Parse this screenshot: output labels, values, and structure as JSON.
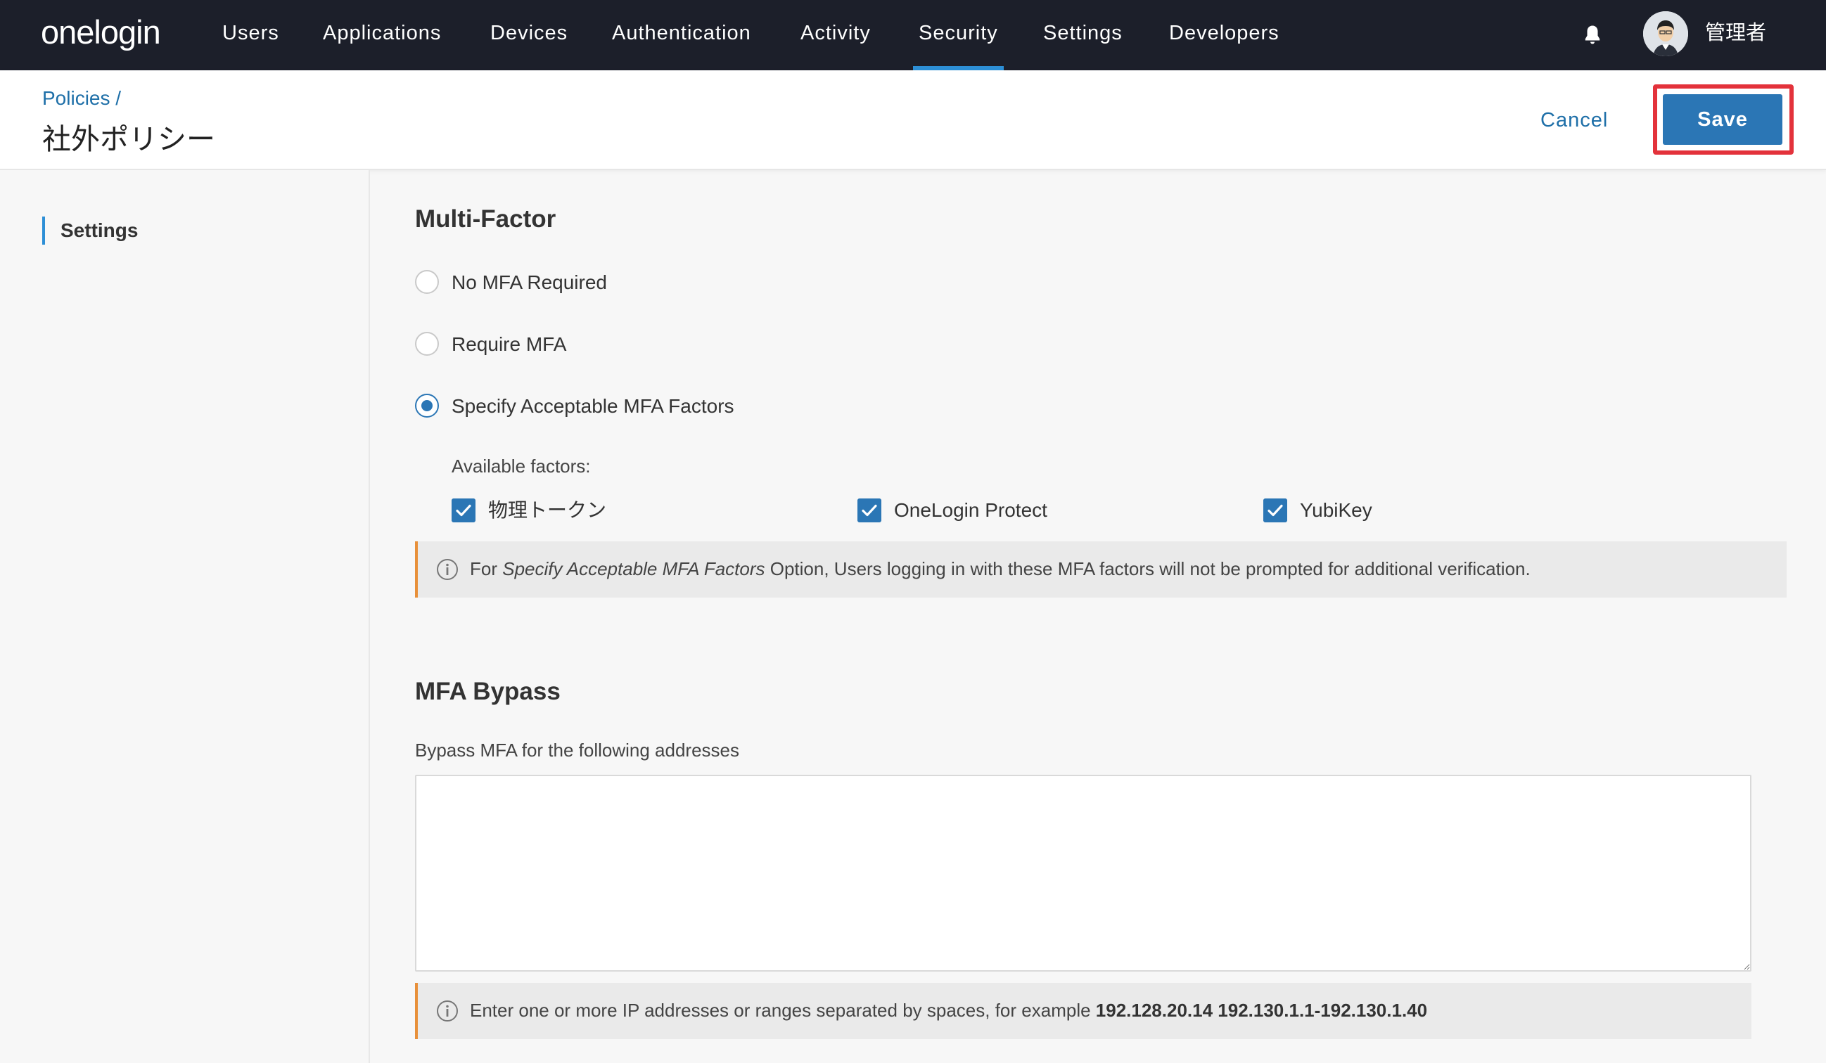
{
  "app": {
    "logo": "onelogin"
  },
  "nav": {
    "items": [
      {
        "label": "Users"
      },
      {
        "label": "Applications"
      },
      {
        "label": "Devices"
      },
      {
        "label": "Authentication"
      },
      {
        "label": "Activity"
      },
      {
        "label": "Security",
        "active": true
      },
      {
        "label": "Settings"
      },
      {
        "label": "Developers"
      }
    ],
    "bell_icon": "bell-icon",
    "user": {
      "name": "管理者"
    }
  },
  "header": {
    "breadcrumb": "Policies /",
    "title": "社外ポリシー",
    "cancel_label": "Cancel",
    "save_label": "Save"
  },
  "sidebar": {
    "items": [
      {
        "label": "Settings",
        "active": true
      }
    ]
  },
  "multifactor": {
    "title": "Multi-Factor",
    "options": [
      {
        "label": "No MFA Required",
        "checked": false
      },
      {
        "label": "Require MFA",
        "checked": false
      },
      {
        "label": "Specify Acceptable MFA Factors",
        "checked": true
      }
    ],
    "available_label": "Available factors:",
    "factors": [
      {
        "label": "物理トークン",
        "checked": true
      },
      {
        "label": "OneLogin Protect",
        "checked": true
      },
      {
        "label": "YubiKey",
        "checked": true
      }
    ],
    "info": {
      "prefix": "For ",
      "emphasis": "Specify Acceptable MFA Factors",
      "suffix": " Option, Users logging in with these MFA factors will not be prompted for additional verification."
    }
  },
  "bypass": {
    "title": "MFA Bypass",
    "label": "Bypass MFA for the following addresses",
    "value": "",
    "info": {
      "prefix": "Enter one or more IP addresses or ranges separated by spaces, for example ",
      "example": "192.128.20.14 192.130.1.1-192.130.1.40"
    }
  },
  "colors": {
    "nav_bg": "#1c1f2a",
    "accent": "#2b76b5",
    "active_indicator": "#2d8fd6",
    "highlight": "#e3323b",
    "info_border": "#e8903a"
  }
}
